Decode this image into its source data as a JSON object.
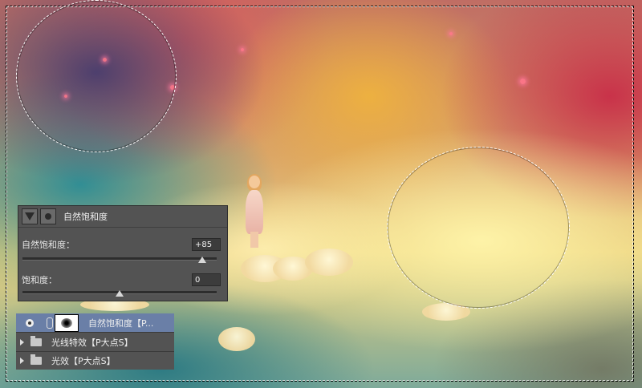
{
  "adjustment_panel": {
    "title": "自然饱和度",
    "vibrance": {
      "label": "自然饱和度：",
      "value": "+85",
      "level_percent": 92.5
    },
    "saturation": {
      "label": "饱和度：",
      "value": "0",
      "level_percent": 50
    }
  },
  "layers": [
    {
      "name": "自然饱和度【P...",
      "type": "adjustment",
      "selected": true
    },
    {
      "name": "光线特效【P大点S】",
      "type": "group",
      "selected": false
    },
    {
      "name": "光效【P大点S】",
      "type": "group",
      "selected": false
    }
  ],
  "colors": {
    "panel_bg": "#535353",
    "layer_selected": "#6a7fa7"
  }
}
